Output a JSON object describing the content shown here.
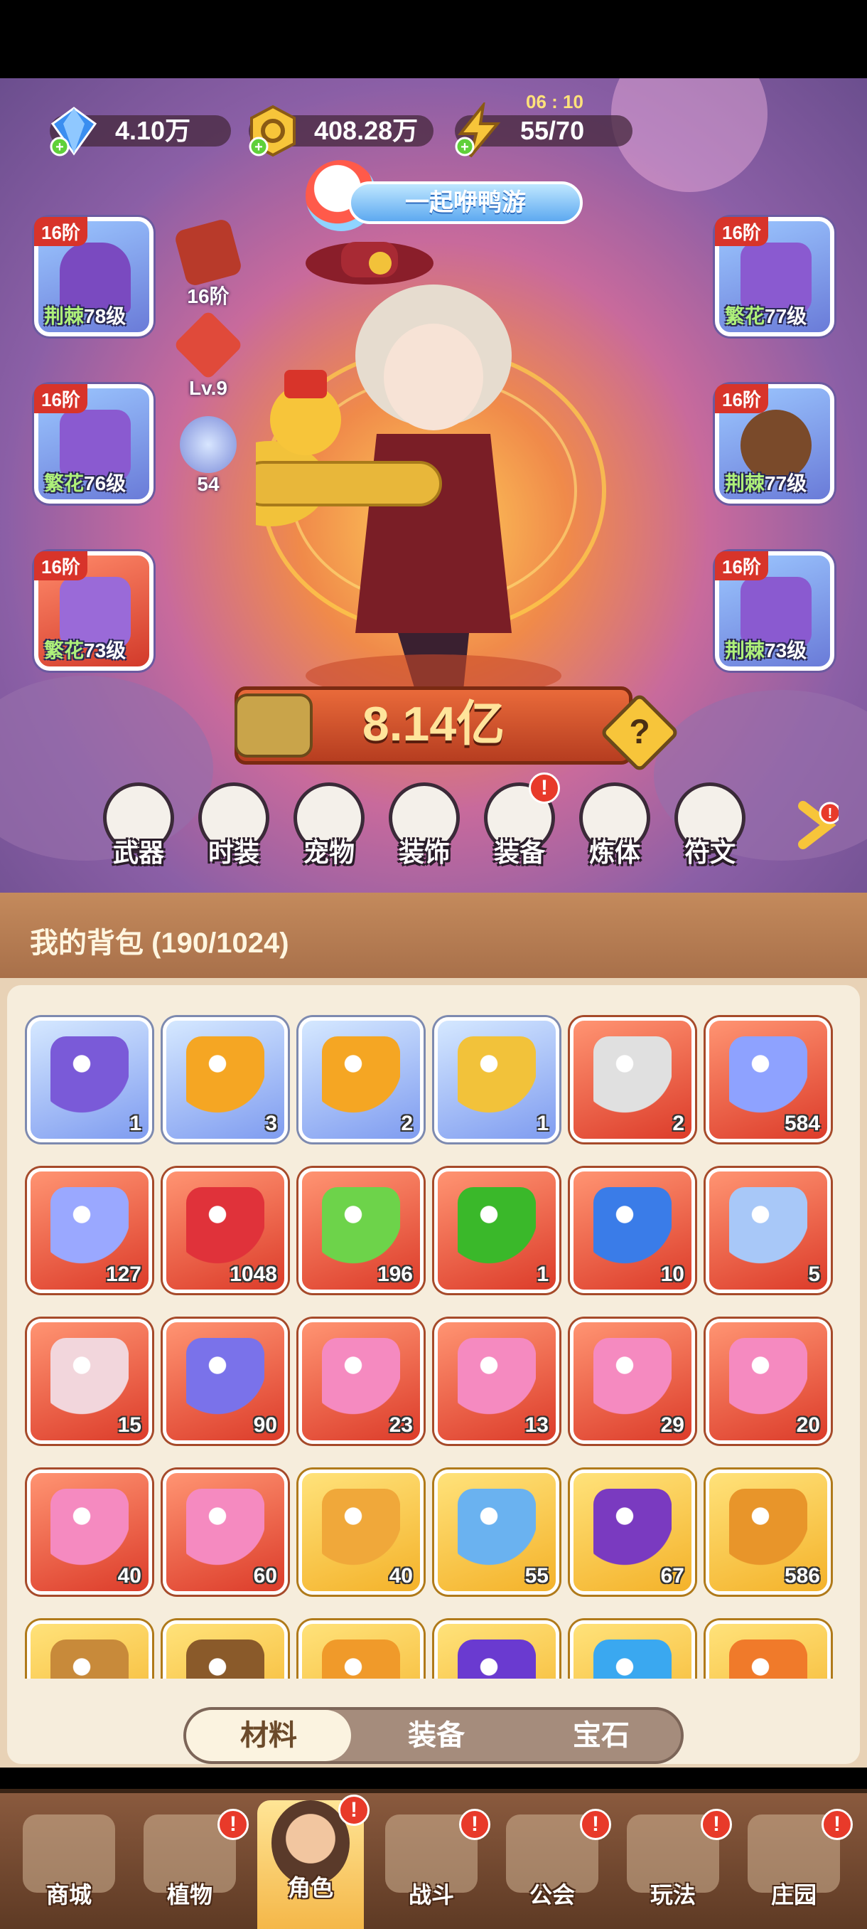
{
  "resources": {
    "gems": "4.10万",
    "gold": "408.28万",
    "energy": "55/70",
    "energy_timer": "06 : 10"
  },
  "event_banner": "一起咿鸭游",
  "equipment_left": [
    {
      "tier": "16阶",
      "quality": "荆棘",
      "level": "78级",
      "color": "blue"
    },
    {
      "tier": "16阶",
      "quality": "繁花",
      "level": "76级",
      "color": "blue"
    },
    {
      "tier": "16阶",
      "quality": "繁花",
      "level": "73级",
      "color": "red"
    }
  ],
  "equipment_right": [
    {
      "tier": "16阶",
      "quality": "繁花",
      "level": "77级",
      "color": "blue"
    },
    {
      "tier": "16阶",
      "quality": "荆棘",
      "level": "77级",
      "color": "blue"
    },
    {
      "tier": "16阶",
      "quality": "荆棘",
      "level": "73级",
      "color": "blue"
    }
  ],
  "mini_stats": [
    {
      "label": "16阶",
      "icon": "scroll-icon"
    },
    {
      "label": "Lv.9",
      "icon": "red-crystal-icon"
    },
    {
      "label": "54",
      "icon": "orbit-icon"
    }
  ],
  "combat_power": "8.14亿",
  "help_symbol": "?",
  "character_tabs": [
    {
      "label": "武器",
      "badge": false
    },
    {
      "label": "时装",
      "badge": false
    },
    {
      "label": "宠物",
      "badge": false
    },
    {
      "label": "装饰",
      "badge": false
    },
    {
      "label": "装备",
      "badge": true
    },
    {
      "label": "炼体",
      "badge": false
    },
    {
      "label": "符文",
      "badge": false
    }
  ],
  "bag": {
    "title": "我的背包 (190/1024)",
    "items": [
      {
        "count": "1",
        "frame": "blue",
        "icon": "mask-icon",
        "tint": "#7a5ad8"
      },
      {
        "count": "3",
        "frame": "blue",
        "icon": "potion-syringe-icon",
        "tint": "#f5a623"
      },
      {
        "count": "2",
        "frame": "blue",
        "icon": "potion-syringe-icon",
        "tint": "#f5a623"
      },
      {
        "count": "1",
        "frame": "blue",
        "icon": "star-icon",
        "tint": "#f2c23a"
      },
      {
        "count": "2",
        "frame": "red",
        "icon": "rune-cross-icon",
        "tint": "#e0e0e0"
      },
      {
        "count": "584",
        "frame": "red",
        "icon": "blue-star-crystal-icon",
        "tint": "#8ea2ff"
      },
      {
        "count": "127",
        "frame": "red",
        "icon": "moon-star-icon",
        "tint": "#9aa8ff"
      },
      {
        "count": "1048",
        "frame": "red",
        "icon": "red-potion-icon",
        "tint": "#e0323a"
      },
      {
        "count": "196",
        "frame": "red",
        "icon": "green-tube-icon",
        "tint": "#6dd34a"
      },
      {
        "count": "1",
        "frame": "red",
        "icon": "green-capsule-icon",
        "tint": "#3ab82a"
      },
      {
        "count": "10",
        "frame": "red",
        "icon": "necklace-icon",
        "tint": "#3a7ce8"
      },
      {
        "count": "5",
        "frame": "red",
        "icon": "hexagram-icon",
        "tint": "#a8c8f8"
      },
      {
        "count": "15",
        "frame": "red",
        "icon": "knot-icon",
        "tint": "#f2d6dc"
      },
      {
        "count": "90",
        "frame": "red",
        "icon": "cube-cluster-icon",
        "tint": "#7a72ea"
      },
      {
        "count": "23",
        "frame": "red",
        "icon": "flower-bud-icon",
        "tint": "#f58ac0"
      },
      {
        "count": "13",
        "frame": "red",
        "icon": "flower-bud-icon",
        "tint": "#f58ac0"
      },
      {
        "count": "29",
        "frame": "red",
        "icon": "flower-bud-icon",
        "tint": "#f58ac0"
      },
      {
        "count": "20",
        "frame": "red",
        "icon": "flower-bud-icon",
        "tint": "#f58ac0"
      },
      {
        "count": "40",
        "frame": "red",
        "icon": "flower-bud-icon",
        "tint": "#f58ac0"
      },
      {
        "count": "60",
        "frame": "red",
        "icon": "flower-bud-icon",
        "tint": "#f58ac0"
      },
      {
        "count": "40",
        "frame": "gold",
        "icon": "golden-bottle-icon",
        "tint": "#f0a83a"
      },
      {
        "count": "55",
        "frame": "gold",
        "icon": "water-drop-icon",
        "tint": "#6ab2f0"
      },
      {
        "count": "67",
        "frame": "gold",
        "icon": "skull-scroll-icon",
        "tint": "#7a3ac0"
      },
      {
        "count": "586",
        "frame": "gold",
        "icon": "mooncake-icon",
        "tint": "#e8952a"
      },
      {
        "count": "",
        "frame": "gold",
        "icon": "pretzel-icon",
        "tint": "#c88a3a"
      },
      {
        "count": "",
        "frame": "gold",
        "icon": "shard-icon",
        "tint": "#8a5a2a"
      },
      {
        "count": "",
        "frame": "gold",
        "icon": "amber-gem-icon",
        "tint": "#f09a2a"
      },
      {
        "count": "",
        "frame": "gold",
        "icon": "purple-orb-icon",
        "tint": "#6a3ad0"
      },
      {
        "count": "",
        "frame": "gold",
        "icon": "blue-mushroom-icon",
        "tint": "#3aa8f0"
      },
      {
        "count": "",
        "frame": "gold",
        "icon": "sun-ring-icon",
        "tint": "#f07a2a"
      }
    ]
  },
  "bag_tabs": [
    {
      "label": "材料",
      "active": true
    },
    {
      "label": "装备",
      "active": false
    },
    {
      "label": "宝石",
      "active": false
    }
  ],
  "bottom_nav": [
    {
      "label": "商城",
      "badge": false,
      "active": false
    },
    {
      "label": "植物",
      "badge": true,
      "active": false
    },
    {
      "label": "角色",
      "badge": true,
      "active": true
    },
    {
      "label": "战斗",
      "badge": true,
      "active": false
    },
    {
      "label": "公会",
      "badge": true,
      "active": false
    },
    {
      "label": "玩法",
      "badge": true,
      "active": false
    },
    {
      "label": "庄园",
      "badge": true,
      "active": false
    }
  ],
  "badge_symbol": "!"
}
